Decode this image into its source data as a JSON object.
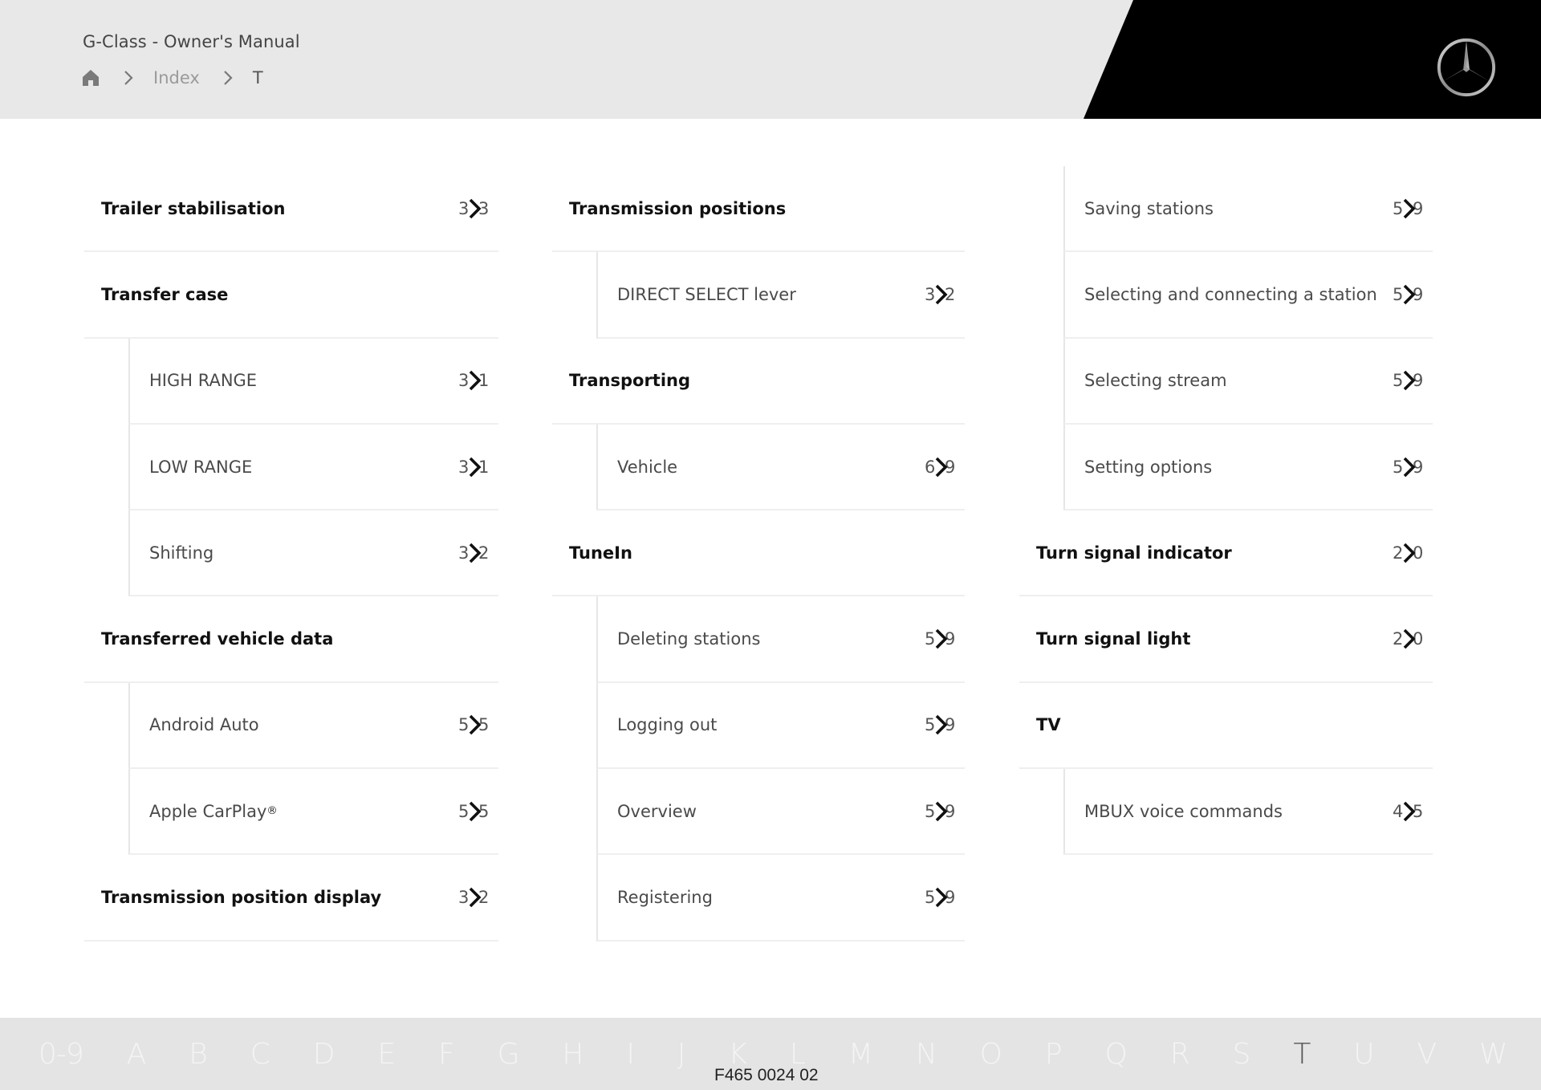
{
  "header": {
    "doc_title": "G-Class - Owner's Manual",
    "breadcrumb": {
      "home_icon": "home-icon",
      "separator_icon": "chevron-right-icon",
      "items": [
        "Index",
        "T"
      ]
    },
    "brand_logo": "mercedes-star-logo"
  },
  "index": {
    "columns": [
      {
        "entries": [
          {
            "label": "Trailer stabilisation",
            "level": "top",
            "page_visible": [
              "3",
              "3"
            ]
          },
          {
            "label": "Transfer case",
            "level": "top",
            "page_visible": null
          },
          {
            "label": "HIGH RANGE",
            "level": "sub",
            "page_visible": [
              "3",
              "1"
            ]
          },
          {
            "label": "LOW RANGE",
            "level": "sub",
            "page_visible": [
              "3",
              "1"
            ]
          },
          {
            "label": "Shifting",
            "level": "sub",
            "page_visible": [
              "3",
              "2"
            ]
          },
          {
            "label": "Transferred vehicle data",
            "level": "top",
            "page_visible": null
          },
          {
            "label": "Android Auto",
            "level": "sub",
            "page_visible": [
              "5",
              "5"
            ]
          },
          {
            "label": "Apple CarPlay",
            "label_sup": "®",
            "level": "sub",
            "page_visible": [
              "5",
              "5"
            ]
          },
          {
            "label": "Transmission position display",
            "level": "top",
            "page_visible": [
              "3",
              "2"
            ]
          }
        ]
      },
      {
        "entries": [
          {
            "label": "Transmission positions",
            "level": "top",
            "page_visible": null
          },
          {
            "label": "DIRECT SELECT lever",
            "level": "sub",
            "page_visible": [
              "3",
              "2"
            ]
          },
          {
            "label": "Transporting",
            "level": "top",
            "page_visible": null
          },
          {
            "label": "Vehicle",
            "level": "sub",
            "page_visible": [
              "6",
              "9"
            ]
          },
          {
            "label": "TuneIn",
            "level": "top",
            "page_visible": null
          },
          {
            "label": "Deleting stations",
            "level": "sub",
            "page_visible": [
              "5",
              "9"
            ]
          },
          {
            "label": "Logging out",
            "level": "sub",
            "page_visible": [
              "5",
              "9"
            ]
          },
          {
            "label": "Overview",
            "level": "sub",
            "page_visible": [
              "5",
              "9"
            ]
          },
          {
            "label": "Registering",
            "level": "sub",
            "page_visible": [
              "5",
              "9"
            ]
          }
        ]
      },
      {
        "entries": [
          {
            "label": "Saving stations",
            "level": "sub",
            "page_visible": [
              "5",
              "9"
            ]
          },
          {
            "label": "Selecting and connecting a station",
            "level": "sub",
            "page_visible": [
              "5",
              "9"
            ]
          },
          {
            "label": "Selecting stream",
            "level": "sub",
            "page_visible": [
              "5",
              "9"
            ]
          },
          {
            "label": "Setting options",
            "level": "sub",
            "page_visible": [
              "5",
              "9"
            ]
          },
          {
            "label": "Turn signal indicator",
            "level": "top",
            "page_visible": [
              "2",
              "0"
            ]
          },
          {
            "label": "Turn signal light",
            "level": "top",
            "page_visible": [
              "2",
              "0"
            ]
          },
          {
            "label": "TV",
            "level": "top",
            "page_visible": null
          },
          {
            "label": "MBUX voice commands",
            "level": "sub",
            "page_visible": [
              "4",
              "5"
            ]
          }
        ]
      }
    ],
    "page_link_icon": "chevron-right-icon"
  },
  "footer": {
    "alphabet": [
      "0-9",
      "A",
      "B",
      "C",
      "D",
      "E",
      "F",
      "G",
      "H",
      "I",
      "J",
      "K",
      "L",
      "M",
      "N",
      "O",
      "P",
      "Q",
      "R",
      "S",
      "T",
      "U",
      "V",
      "W"
    ],
    "active_letter": "T",
    "doc_code": "F465 0024 02"
  },
  "colors": {
    "header_bg": "#e8e8e8",
    "brand_black": "#000000",
    "text_primary": "#111111",
    "text_secondary": "#4a4a4a",
    "footer_bg": "#e4e4e4",
    "alphabet_inactive": "#f4f4f4",
    "alphabet_active": "#555555"
  }
}
